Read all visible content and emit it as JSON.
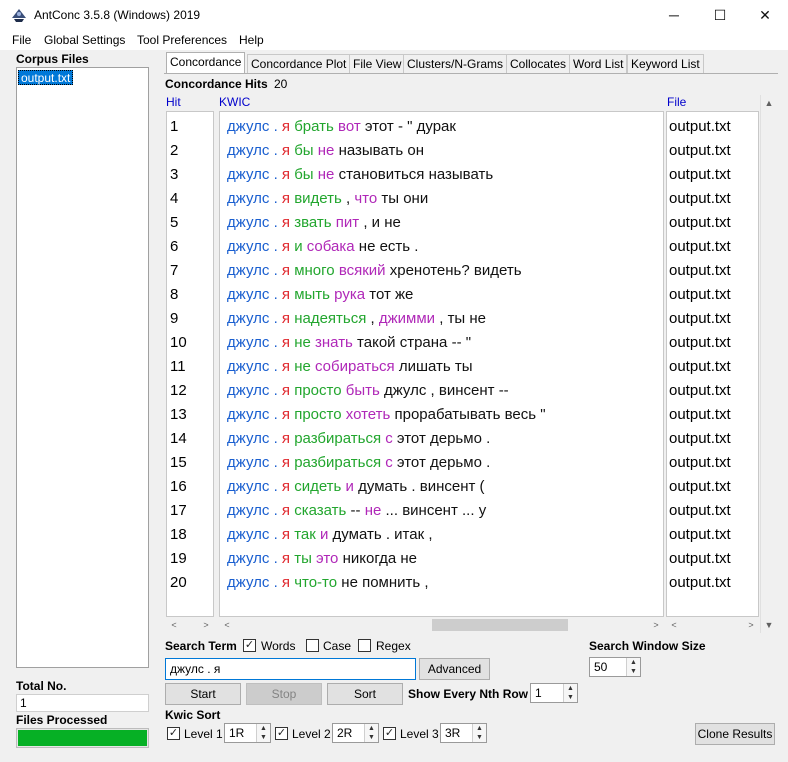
{
  "window": {
    "title": "AntConc 3.5.8 (Windows) 2019",
    "minimize_icon": "─",
    "maximize_icon": "☐",
    "close_icon": "✕"
  },
  "menu": [
    "File",
    "Global Settings",
    "Tool Preferences",
    "Help"
  ],
  "corpus": {
    "title": "Corpus Files",
    "files": [
      "output.txt"
    ],
    "total_label": "Total No.",
    "total_value": "1",
    "processed_label": "Files Processed",
    "progress_fraction": 1.0
  },
  "tabs": [
    "Concordance",
    "Concordance Plot",
    "File View",
    "Clusters/N-Grams",
    "Collocates",
    "Word List",
    "Keyword List"
  ],
  "concordance": {
    "hits_label": "Concordance Hits",
    "hits_value": "20",
    "col_hit": "Hit",
    "col_kwic": "KWIC",
    "col_file": "File",
    "rows": [
      {
        "hit": "1",
        "file": "output.txt",
        "kwic": [
          [
            "s1",
            "джулс"
          ],
          [
            "s1",
            "."
          ],
          [
            "ya",
            "я"
          ],
          [
            "g",
            "брать"
          ],
          [
            "p",
            "вот"
          ],
          [
            "k",
            "этот"
          ],
          [
            "k",
            "- \" дурак"
          ]
        ]
      },
      {
        "hit": "2",
        "file": "output.txt",
        "kwic": [
          [
            "s1",
            "джулс"
          ],
          [
            "s1",
            "."
          ],
          [
            "ya",
            "я"
          ],
          [
            "g",
            "бы"
          ],
          [
            "p",
            "не"
          ],
          [
            "k",
            "называть"
          ],
          [
            "k",
            "он"
          ]
        ]
      },
      {
        "hit": "3",
        "file": "output.txt",
        "kwic": [
          [
            "s1",
            "джулс"
          ],
          [
            "s1",
            "."
          ],
          [
            "ya",
            "я"
          ],
          [
            "g",
            "бы"
          ],
          [
            "p",
            "не"
          ],
          [
            "k",
            "становиться"
          ],
          [
            "k",
            "называть"
          ]
        ]
      },
      {
        "hit": "4",
        "file": "output.txt",
        "kwic": [
          [
            "s1",
            "джулс"
          ],
          [
            "s1",
            "."
          ],
          [
            "ya",
            "я"
          ],
          [
            "g",
            "видеть"
          ],
          [
            "k",
            ","
          ],
          [
            "p",
            "что"
          ],
          [
            "k",
            "ты"
          ],
          [
            "k",
            "они"
          ]
        ]
      },
      {
        "hit": "5",
        "file": "output.txt",
        "kwic": [
          [
            "s1",
            "джулс"
          ],
          [
            "s1",
            "."
          ],
          [
            "ya",
            "я"
          ],
          [
            "g",
            "звать"
          ],
          [
            "p",
            "пит"
          ],
          [
            "k",
            ","
          ],
          [
            "k",
            "и"
          ],
          [
            "k",
            "не"
          ]
        ]
      },
      {
        "hit": "6",
        "file": "output.txt",
        "kwic": [
          [
            "s1",
            "джулс"
          ],
          [
            "s1",
            "."
          ],
          [
            "ya",
            "я"
          ],
          [
            "g",
            "и"
          ],
          [
            "p",
            "собака"
          ],
          [
            "k",
            "не"
          ],
          [
            "k",
            "есть"
          ],
          [
            "k",
            "."
          ]
        ]
      },
      {
        "hit": "7",
        "file": "output.txt",
        "kwic": [
          [
            "s1",
            "джулс"
          ],
          [
            "s1",
            "."
          ],
          [
            "ya",
            "я"
          ],
          [
            "g",
            "много"
          ],
          [
            "p",
            "всякий"
          ],
          [
            "k",
            "хренотень?"
          ],
          [
            "k",
            "видеть"
          ]
        ]
      },
      {
        "hit": "8",
        "file": "output.txt",
        "kwic": [
          [
            "s1",
            "джулс"
          ],
          [
            "s1",
            "."
          ],
          [
            "ya",
            "я"
          ],
          [
            "g",
            "мыть"
          ],
          [
            "p",
            "рука"
          ],
          [
            "k",
            "тот"
          ],
          [
            "k",
            "же"
          ]
        ]
      },
      {
        "hit": "9",
        "file": "output.txt",
        "kwic": [
          [
            "s1",
            "джулс"
          ],
          [
            "s1",
            "."
          ],
          [
            "ya",
            "я"
          ],
          [
            "g",
            "надеяться"
          ],
          [
            "k",
            ","
          ],
          [
            "p",
            "джимми"
          ],
          [
            "k",
            ","
          ],
          [
            "k",
            "ты"
          ],
          [
            "k",
            "не"
          ]
        ]
      },
      {
        "hit": "10",
        "file": "output.txt",
        "kwic": [
          [
            "s1",
            "джулс"
          ],
          [
            "s1",
            "."
          ],
          [
            "ya",
            "я"
          ],
          [
            "g",
            "не"
          ],
          [
            "p",
            "знать"
          ],
          [
            "k",
            "такой"
          ],
          [
            "k",
            "страна"
          ],
          [
            "k",
            "-- \""
          ]
        ]
      },
      {
        "hit": "11",
        "file": "output.txt",
        "kwic": [
          [
            "s1",
            "джулс"
          ],
          [
            "s1",
            "."
          ],
          [
            "ya",
            "я"
          ],
          [
            "g",
            "не"
          ],
          [
            "p",
            "собираться"
          ],
          [
            "k",
            "лишать"
          ],
          [
            "k",
            "ты"
          ]
        ]
      },
      {
        "hit": "12",
        "file": "output.txt",
        "kwic": [
          [
            "s1",
            "джулс"
          ],
          [
            "s1",
            "."
          ],
          [
            "ya",
            "я"
          ],
          [
            "g",
            "просто"
          ],
          [
            "p",
            "быть"
          ],
          [
            "k",
            "джулс"
          ],
          [
            "k",
            ","
          ],
          [
            "k",
            "винсент"
          ],
          [
            "k",
            "--"
          ]
        ]
      },
      {
        "hit": "13",
        "file": "output.txt",
        "kwic": [
          [
            "s1",
            "джулс"
          ],
          [
            "s1",
            "."
          ],
          [
            "ya",
            "я"
          ],
          [
            "g",
            "просто"
          ],
          [
            "p",
            "хотеть"
          ],
          [
            "k",
            "прорабатывать"
          ],
          [
            "k",
            "весь"
          ],
          [
            "k",
            "\""
          ]
        ]
      },
      {
        "hit": "14",
        "file": "output.txt",
        "kwic": [
          [
            "s1",
            "джулс"
          ],
          [
            "s1",
            "."
          ],
          [
            "ya",
            "я"
          ],
          [
            "g",
            "разбираться"
          ],
          [
            "p",
            "с"
          ],
          [
            "k",
            "этот"
          ],
          [
            "k",
            "дерьмо"
          ],
          [
            "k",
            "."
          ]
        ]
      },
      {
        "hit": "15",
        "file": "output.txt",
        "kwic": [
          [
            "s1",
            "джулс"
          ],
          [
            "s1",
            "."
          ],
          [
            "ya",
            "я"
          ],
          [
            "g",
            "разбираться"
          ],
          [
            "p",
            "с"
          ],
          [
            "k",
            "этот"
          ],
          [
            "k",
            "дерьмо"
          ],
          [
            "k",
            "."
          ]
        ]
      },
      {
        "hit": "16",
        "file": "output.txt",
        "kwic": [
          [
            "s1",
            "джулс"
          ],
          [
            "s1",
            "."
          ],
          [
            "ya",
            "я"
          ],
          [
            "g",
            "сидеть"
          ],
          [
            "p",
            "и"
          ],
          [
            "k",
            "думать"
          ],
          [
            "k",
            "."
          ],
          [
            "k",
            "винсент"
          ],
          [
            "k",
            "("
          ]
        ]
      },
      {
        "hit": "17",
        "file": "output.txt",
        "kwic": [
          [
            "s1",
            "джулс"
          ],
          [
            "s1",
            "."
          ],
          [
            "ya",
            "я"
          ],
          [
            "g",
            "сказать"
          ],
          [
            "k",
            "--"
          ],
          [
            "p",
            "не"
          ],
          [
            "k",
            "..."
          ],
          [
            "k",
            "винсент"
          ],
          [
            "k",
            "..."
          ],
          [
            "k",
            "у"
          ]
        ]
      },
      {
        "hit": "18",
        "file": "output.txt",
        "kwic": [
          [
            "s1",
            "джулс"
          ],
          [
            "s1",
            "."
          ],
          [
            "ya",
            "я"
          ],
          [
            "g",
            "так"
          ],
          [
            "p",
            "и"
          ],
          [
            "k",
            "думать"
          ],
          [
            "k",
            "."
          ],
          [
            "k",
            "итак"
          ],
          [
            "k",
            ","
          ]
        ]
      },
      {
        "hit": "19",
        "file": "output.txt",
        "kwic": [
          [
            "s1",
            "джулс"
          ],
          [
            "s1",
            "."
          ],
          [
            "ya",
            "я"
          ],
          [
            "g",
            "ты"
          ],
          [
            "p",
            "это"
          ],
          [
            "k",
            "никогда"
          ],
          [
            "k",
            "не"
          ]
        ]
      },
      {
        "hit": "20",
        "file": "output.txt",
        "kwic": [
          [
            "s1",
            "джулс"
          ],
          [
            "s1",
            "."
          ],
          [
            "ya",
            "я"
          ],
          [
            "g",
            "что-то"
          ],
          [
            "k",
            "не"
          ],
          [
            "k",
            "помнить"
          ],
          [
            "k",
            ","
          ]
        ]
      }
    ]
  },
  "search": {
    "term_label": "Search Term",
    "words_label": "Words",
    "words_checked": true,
    "case_label": "Case",
    "case_checked": false,
    "regex_label": "Regex",
    "regex_checked": false,
    "value": "джулс . я",
    "advanced_label": "Advanced",
    "window_size_label": "Search Window Size",
    "window_size_value": "50",
    "start_label": "Start",
    "stop_label": "Stop",
    "sort_label": "Sort",
    "nth_label": "Show Every Nth Row",
    "nth_value": "1"
  },
  "kwic_sort": {
    "title": "Kwic Sort",
    "level1_label": "Level 1",
    "level1_value": "1R",
    "level1_checked": true,
    "level2_label": "Level 2",
    "level2_value": "2R",
    "level2_checked": true,
    "level3_label": "Level 3",
    "level3_value": "3R",
    "level3_checked": true,
    "clone_label": "Clone Results"
  },
  "colors": {
    "accent": "#0078d7",
    "kwic_blue": "#1a5fd0",
    "kwic_red": "#e0282e",
    "kwic_green": "#22a62e",
    "kwic_purple": "#b028b8",
    "progress_green": "#06b025"
  },
  "icons": {
    "app": "antconc-app-icon",
    "check": "✓",
    "arrow_left": "<",
    "arrow_right": ">",
    "arrow_up": "▲",
    "arrow_down": "▼"
  }
}
